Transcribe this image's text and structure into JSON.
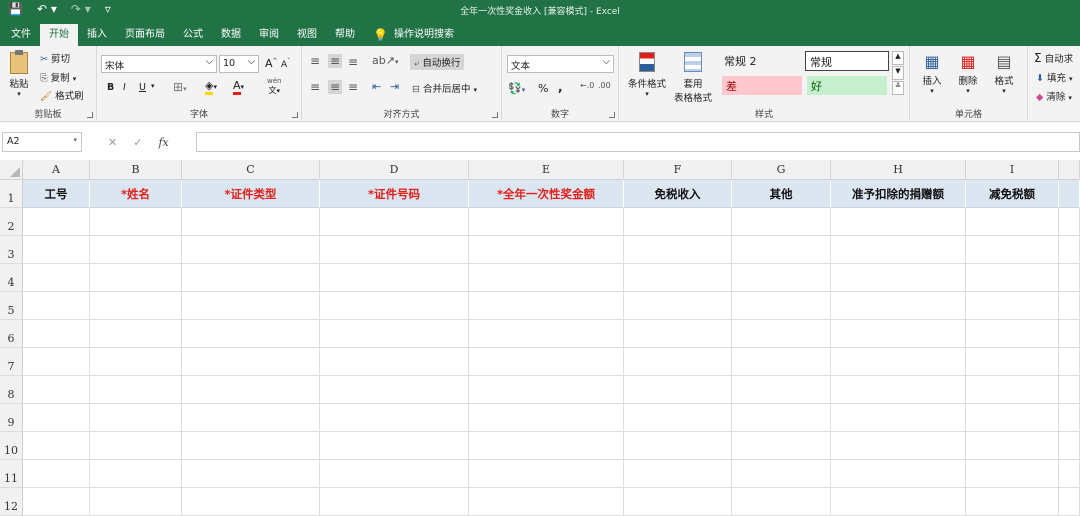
{
  "window": {
    "title": "全年一次性奖金收入  [兼容模式]  -  Excel",
    "qat": [
      "💾",
      "↶ ▾",
      "↷ ▾",
      "▿"
    ]
  },
  "tabs": [
    "文件",
    "开始",
    "插入",
    "页面布局",
    "公式",
    "数据",
    "审阅",
    "视图",
    "帮助"
  ],
  "search_tab": "操作说明搜索",
  "ribbon": {
    "clipboard": {
      "paste": "粘贴",
      "cut": "剪切",
      "copy": "复制",
      "format_painter": "格式刷",
      "label": "剪贴板"
    },
    "font": {
      "name": "宋体",
      "size": "10",
      "bold": "B",
      "italic": "I",
      "underline": "U",
      "grow": "A",
      "shrink": "A",
      "wen": "wén",
      "label": "字体"
    },
    "align": {
      "wrap": "自动换行",
      "merge": "合并后居中",
      "label": "对齐方式"
    },
    "number": {
      "format": "文本",
      "percent": "%",
      "comma": ",",
      "label": "数字"
    },
    "styles": {
      "cond": "条件格式",
      "table1": "套用",
      "table2": "表格格式",
      "s1": "常规 2",
      "s2": "常规",
      "s3": "差",
      "s4": "好",
      "label": "样式"
    },
    "cells": {
      "insert": "插入",
      "delete": "删除",
      "format": "格式",
      "label": "单元格"
    },
    "editing": {
      "autosum": "自动求",
      "fill": "填充",
      "clear": "清除"
    }
  },
  "formula_bar": {
    "name_box": "A2",
    "fx": "fx",
    "value": ""
  },
  "columns": [
    "A",
    "B",
    "C",
    "D",
    "E",
    "F",
    "G",
    "H",
    "I"
  ],
  "rows": [
    "1",
    "2",
    "3",
    "4",
    "5",
    "6",
    "7",
    "8",
    "9",
    "10",
    "11",
    "12"
  ],
  "headers": [
    "工号",
    "*姓名",
    "*证件类型",
    "*证件号码",
    "*全年一次性奖金额",
    "免税收入",
    "其他",
    "准予扣除的捐赠额",
    "减免税额"
  ],
  "header_required": [
    false,
    true,
    true,
    true,
    true,
    false,
    false,
    false,
    false
  ],
  "colors": {
    "excel_green": "#217346",
    "required_red": "#e0201b",
    "header_fill": "#dce6f1",
    "bad_fill": "#ffc7ce",
    "good_fill": "#c6efce"
  }
}
